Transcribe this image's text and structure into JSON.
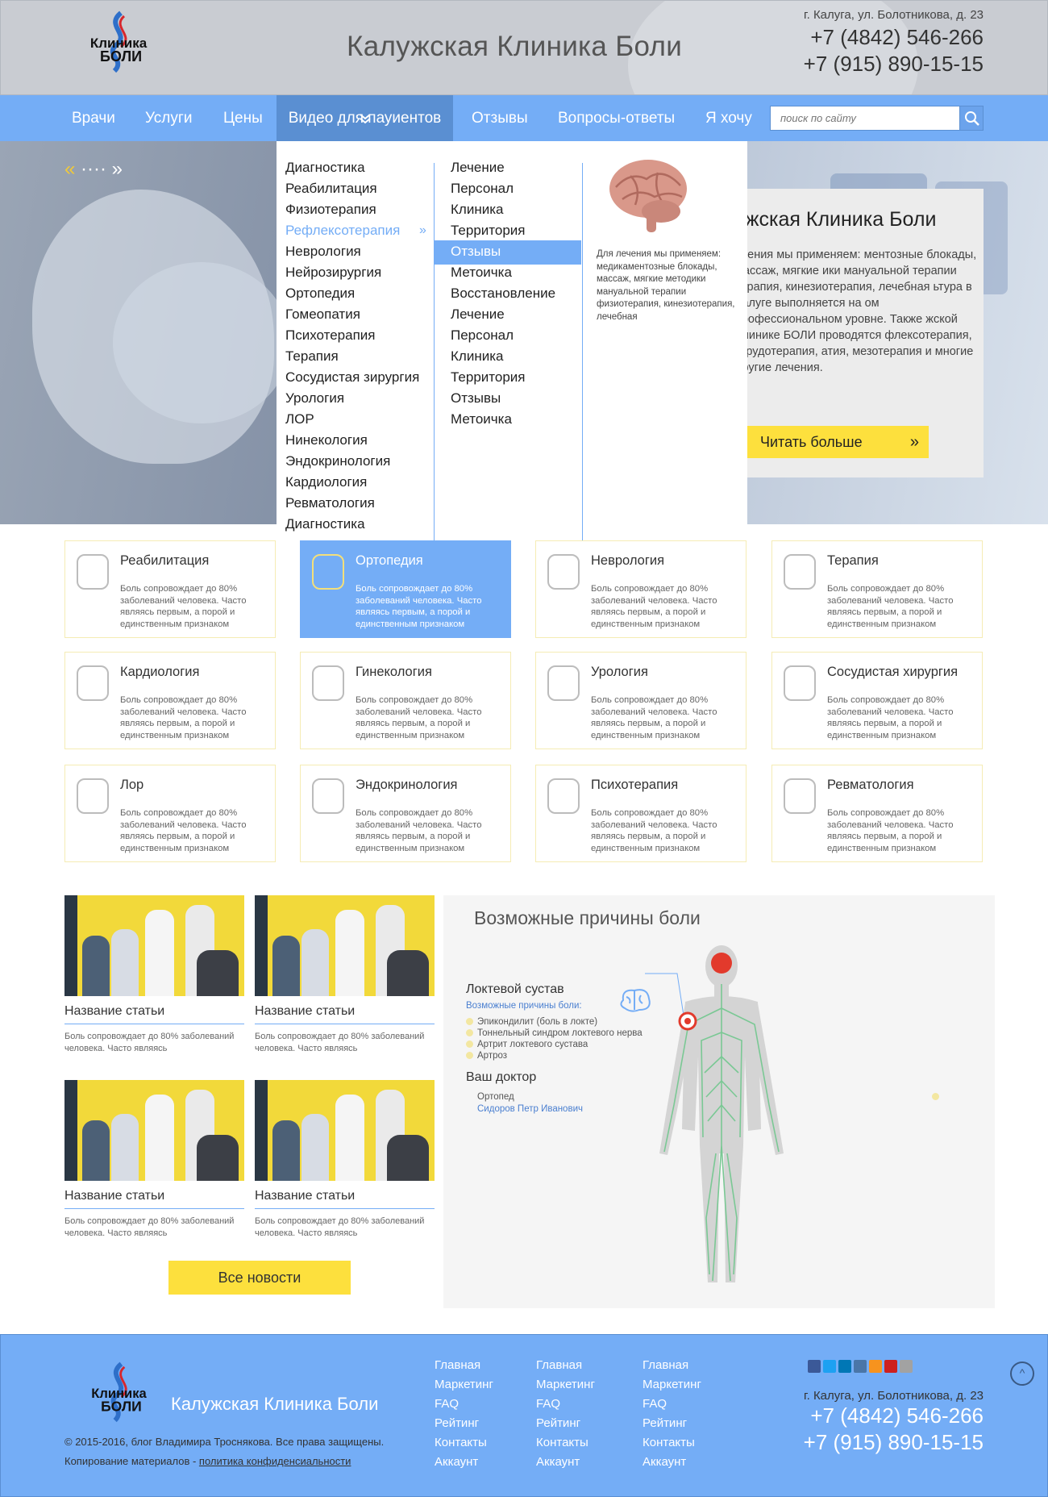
{
  "header": {
    "logo_line1": "Клиника",
    "logo_line2": "БОЛИ",
    "title": "Калужская Клиника Боли",
    "address": "г. Калуга, ул. Болотникова, д. 23",
    "phone1": "+7 (4842) 546-266",
    "phone2": "+7 (915) 890-15-15"
  },
  "nav": {
    "items": [
      "Врачи",
      "Услуги",
      "Цены",
      "Видео для пауиентов",
      "Отзывы",
      "Вопросы-ответы",
      "Я хочу"
    ],
    "active_index": 3,
    "chevron": "»",
    "search_placeholder": "поиск по сайту"
  },
  "slider": {
    "prev": "«",
    "dots": "····",
    "next": "»"
  },
  "mega_menu": {
    "col1": [
      "Диагностика",
      "Реабилитация",
      "Физиотерапия",
      "Рефлексотерапия",
      "Неврология",
      "Нейрозирургия",
      "Ортопедия",
      "Гомеопатия",
      "Психотерапия",
      "Терапия",
      "Сосудистая зирургия",
      "Урология",
      "ЛОР",
      "Нинекология",
      "Эндокринология",
      "Кардиология",
      "Ревматология",
      "Диагностика"
    ],
    "col1_highlight_index": 3,
    "col1_arrow": "»",
    "col2": [
      "Лечение",
      "Персонал",
      "Клиника",
      "Территория",
      "Отзывы",
      "Метоичка",
      "Восстановление",
      "Лечение",
      "Персонал",
      "Клиника",
      "Территория",
      "Отзывы",
      "Метоичка"
    ],
    "col2_active_index": 4,
    "promo_text": "Для лечения мы применяем: медикаментозные блокады, массаж, мягкие методики мануальной терапии физиотерапия, кинезиотерапия, лечебная"
  },
  "hero_card": {
    "title": "ужская Клиника Боли",
    "text": "ечения мы применяем: ментозные блокады, массаж, мягкие ики мануальной терапии терапия, кинезиотерапия, лечебная ьтура в Калуге выполняется на ом профессиональном уровне. Также жской Клинике БОЛИ проводятся флексотерапия, гирудотерапия, атия, мезотерапия и многие другие лечения.",
    "button": "Читать больше",
    "button_arrow": "»"
  },
  "services": [
    {
      "title": "Реабилитация",
      "icon": "scale-icon",
      "desc": "Боль сопровождает до 80% заболеваний человека. Часто являясь первым, а порой и единственным признаком"
    },
    {
      "title": "Ортопедия",
      "icon": "knee-joint-icon",
      "desc": "Боль сопровождает до 80% заболеваний человека. Часто являясь первым, а порой и единственным признаком"
    },
    {
      "title": "Неврология",
      "icon": "brain-icon",
      "desc": "Боль сопровождает до 80% заболеваний человека. Часто являясь первым, а порой и единственным признаком"
    },
    {
      "title": "Терапия",
      "icon": "stethoscope-icon",
      "desc": "Боль сопровождает до 80% заболеваний человека. Часто являясь первым, а порой и единственным признаком"
    },
    {
      "title": "Кардиология",
      "icon": "heart-pulse-icon",
      "desc": "Боль сопровождает до 80% заболеваний человека. Часто являясь первым, а порой и единственным признаком"
    },
    {
      "title": "Гинекология",
      "icon": "ultrasound-icon",
      "desc": "Боль сопровождает до 80% заболеваний человека. Часто являясь первым, а порой и единственным признаком"
    },
    {
      "title": "Урология",
      "icon": "kidneys-icon",
      "desc": "Боль сопровождает до 80% заболеваний человека. Часто являясь первым, а порой и единственным признаком"
    },
    {
      "title": "Сосудистая хирургия",
      "icon": "surgeon-icon",
      "desc": "Боль сопровождает до 80% заболеваний человека. Часто являясь первым, а порой и единственным признаком"
    },
    {
      "title": "Лор",
      "icon": "ear-icon",
      "desc": "Боль сопровождает до 80% заболеваний человека. Часто являясь первым, а порой и единственным признаком"
    },
    {
      "title": "Эндокринология",
      "icon": "thyroid-icon",
      "desc": "Боль сопровождает до 80% заболеваний человека. Часто являясь первым, а порой и единственным признаком"
    },
    {
      "title": "Психотерапия",
      "icon": "chat-bubbles-icon",
      "desc": "Боль сопровождает до 80% заболеваний человека. Часто являясь первым, а порой и единственным признаком"
    },
    {
      "title": "Ревматология",
      "icon": "spine-icon",
      "desc": "Боль сопровождает до 80% заболеваний человека. Часто являясь первым, а порой и единственным признаком"
    }
  ],
  "services_active_index": 1,
  "news": [
    {
      "title": "Название статьи",
      "desc": "Боль сопровождает до 80% заболеваний человека. Часто являясь"
    },
    {
      "title": "Название статьи",
      "desc": "Боль сопровождает до 80% заболеваний человека. Часто являясь"
    },
    {
      "title": "Название статьи",
      "desc": "Боль сопровождает до 80% заболеваний человека. Часто являясь"
    },
    {
      "title": "Название статьи",
      "desc": "Боль сопровождает до 80% заболеваний человека. Часто являясь"
    }
  ],
  "all_news": "Все новости",
  "pain": {
    "title": "Возможные причины боли",
    "joint": "Локтевой сустав",
    "causes_label": "Возможные причины боли:",
    "causes": [
      "Эпикондилит (боль в локте)",
      "Тоннельный синдром локтевого нерва",
      "Артрит локтевого сустава",
      "Артроз"
    ],
    "doctor_title": "Ваш доктор",
    "doctor_spec": "Ортопед",
    "doctor_name": "Сидоров Петр Иванович"
  },
  "footer": {
    "title": "Калужская Клиника Боли",
    "copyright": "© 2015-2016, блог Владимира Троснякова. Все права защищены.",
    "copy_prefix": "Копирование материалов - ",
    "policy_link": "политика конфиденсиальности",
    "columns": [
      [
        "Главная",
        "Маркетинг",
        "FAQ",
        "Рейтинг",
        "Контакты",
        "Аккаунт"
      ],
      [
        "Главная",
        "Маркетинг",
        "FAQ",
        "Рейтинг",
        "Контакты",
        "Аккаунт"
      ],
      [
        "Главная",
        "Маркетинг",
        "FAQ",
        "Рейтинг",
        "Контакты",
        "Аккаунт"
      ]
    ],
    "socials": [
      {
        "name": "facebook-icon",
        "color": "#3b5998"
      },
      {
        "name": "twitter-icon",
        "color": "#1da1f2"
      },
      {
        "name": "linkedin-icon",
        "color": "#0077b5"
      },
      {
        "name": "vk-icon",
        "color": "#4a76a8"
      },
      {
        "name": "odnoklassniki-icon",
        "color": "#f7931e"
      },
      {
        "name": "youtube-icon",
        "color": "#cd201f"
      },
      {
        "name": "instagram-icon",
        "color": "#a2a2a2"
      }
    ],
    "address": "г. Калуга, ул. Болотникова, д. 23",
    "phone1": "+7 (4842) 546-266",
    "phone2": "+7 (915) 890-15-15",
    "to_top": "^"
  },
  "colors": {
    "accent": "#74adf6",
    "nav_active": "#5a8fd2",
    "yellow": "#fde03d"
  }
}
